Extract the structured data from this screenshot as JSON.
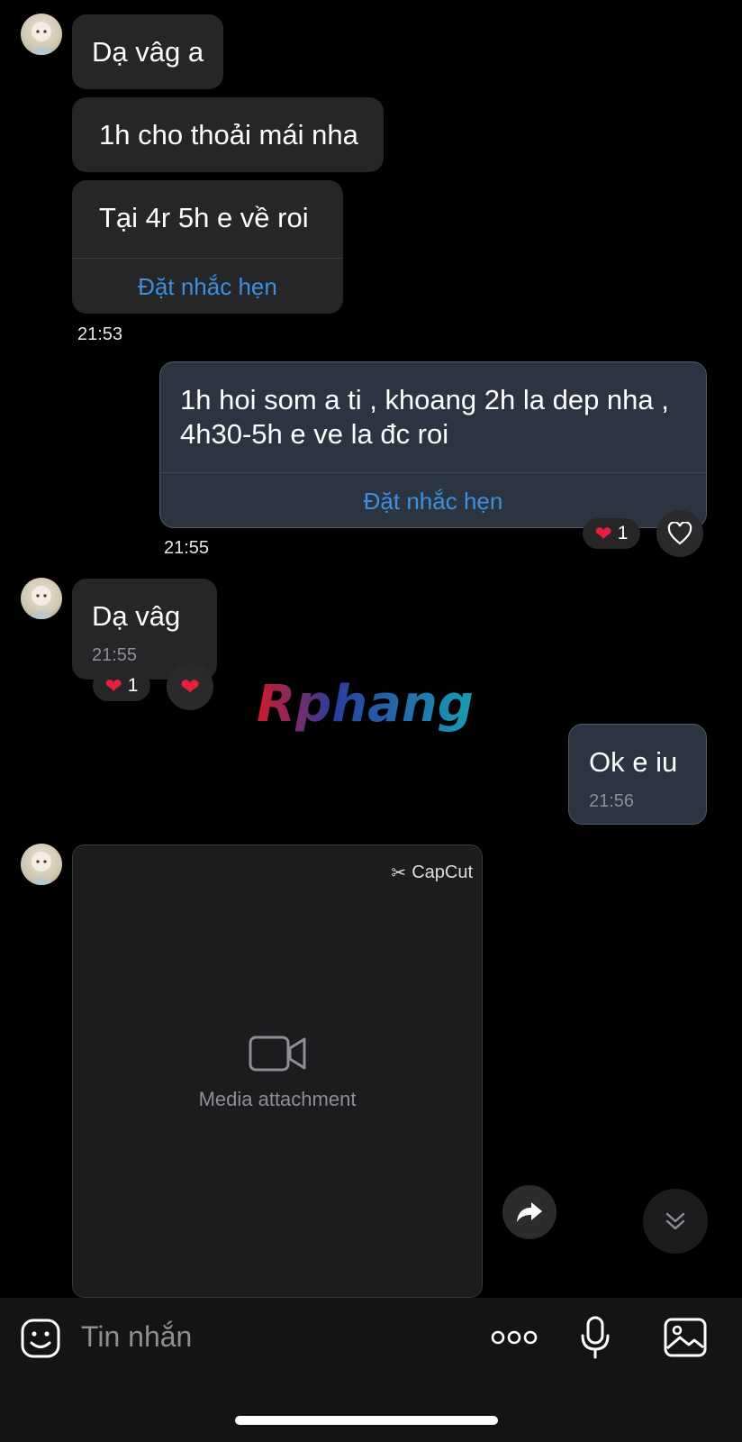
{
  "messages": [
    {
      "id": "m1",
      "direction": "incoming",
      "text": "Dạ vâg a"
    },
    {
      "id": "m2",
      "direction": "incoming",
      "text": "1h cho thoải mái nha"
    },
    {
      "id": "m3",
      "direction": "incoming",
      "text": "Tại 4r 5h e về roi",
      "action": "Đặt nhắc hẹn",
      "time": "21:53"
    },
    {
      "id": "m4",
      "direction": "outgoing",
      "text_line1": "1h hoi som a ti , khoang 2h la dep nha ,",
      "text_line2": "4h30-5h e ve la đc roi",
      "action": "Đặt nhắc hẹn",
      "time": "21:55",
      "reaction_count": "1"
    },
    {
      "id": "m5",
      "direction": "incoming",
      "text": "Dạ vâg",
      "time": "21:55",
      "reaction_count": "1"
    },
    {
      "id": "m6",
      "direction": "outgoing",
      "text": "Ok e iu",
      "time": "21:56"
    },
    {
      "id": "m7",
      "direction": "incoming",
      "type": "media",
      "media_label": "CapCut"
    }
  ],
  "watermark": "Rphang",
  "media_notice": "Media attachment",
  "composer": {
    "placeholder": "Tin nhắn"
  },
  "colors": {
    "background": "#000000",
    "incoming_bubble": "#262628",
    "outgoing_bubble": "#2b3440",
    "link": "#3d8fe0",
    "heart": "#e5213d"
  },
  "icons": [
    "sticker-icon",
    "more-icon",
    "microphone-icon",
    "image-icon",
    "heart-icon",
    "forward-icon",
    "scroll-down-icon"
  ]
}
